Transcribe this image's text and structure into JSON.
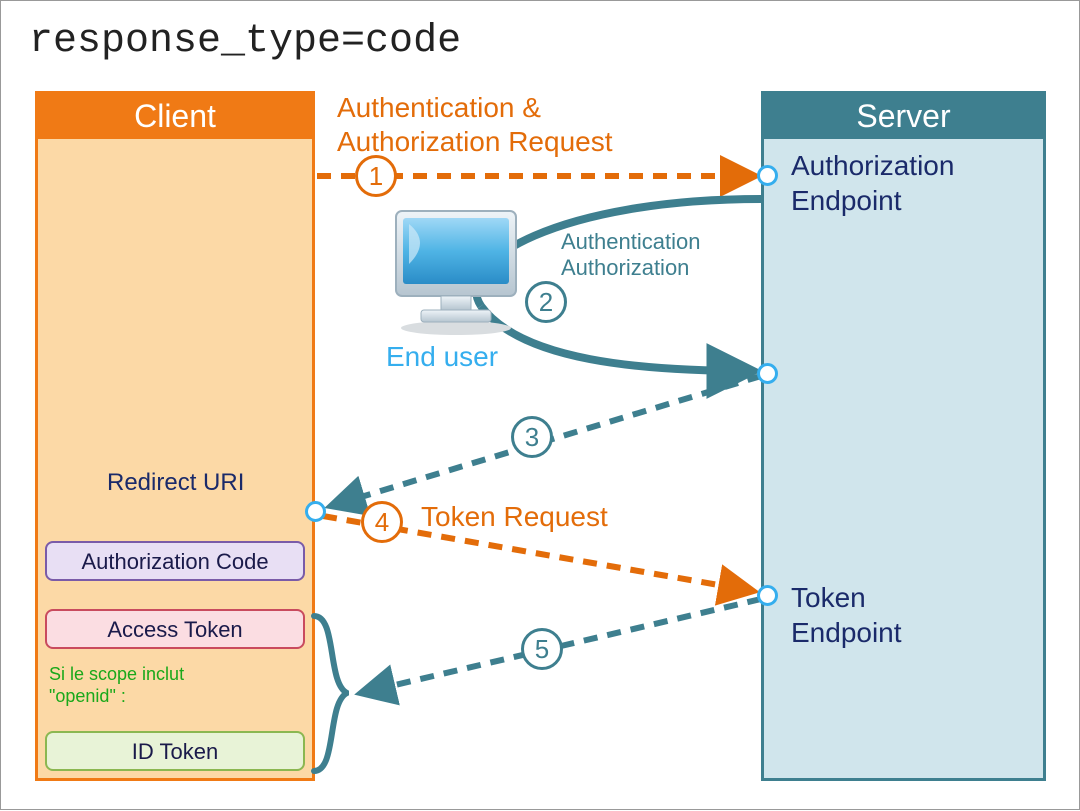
{
  "title": "response_type=code",
  "client": {
    "header": "Client"
  },
  "server": {
    "header": "Server"
  },
  "labels": {
    "auth_request_line1": "Authentication &",
    "auth_request_line2": "Authorization Request",
    "auth_endpoint_line1": "Authorization",
    "auth_endpoint_line2": "Endpoint",
    "token_endpoint_line1": "Token",
    "token_endpoint_line2": "Endpoint",
    "auth_auth_line1": "Authentication",
    "auth_auth_line2": "Authorization",
    "end_user": "End user",
    "redirect_uri": "Redirect URI",
    "token_request": "Token Request"
  },
  "tokens": {
    "authorization_code": "Authorization Code",
    "access_token": "Access Token",
    "id_token": "ID Token",
    "scope_note_line1": "Si le scope inclut",
    "scope_note_line2": "\"openid\" :"
  },
  "steps": {
    "s1": "1",
    "s2": "2",
    "s3": "3",
    "s4": "4",
    "s5": "5"
  },
  "colors": {
    "orange": "#e36c09",
    "teal": "#3e7f8f",
    "client_bg": "#fcd9a6",
    "server_bg": "#d0e5ec",
    "blue_light": "#35aeee"
  }
}
